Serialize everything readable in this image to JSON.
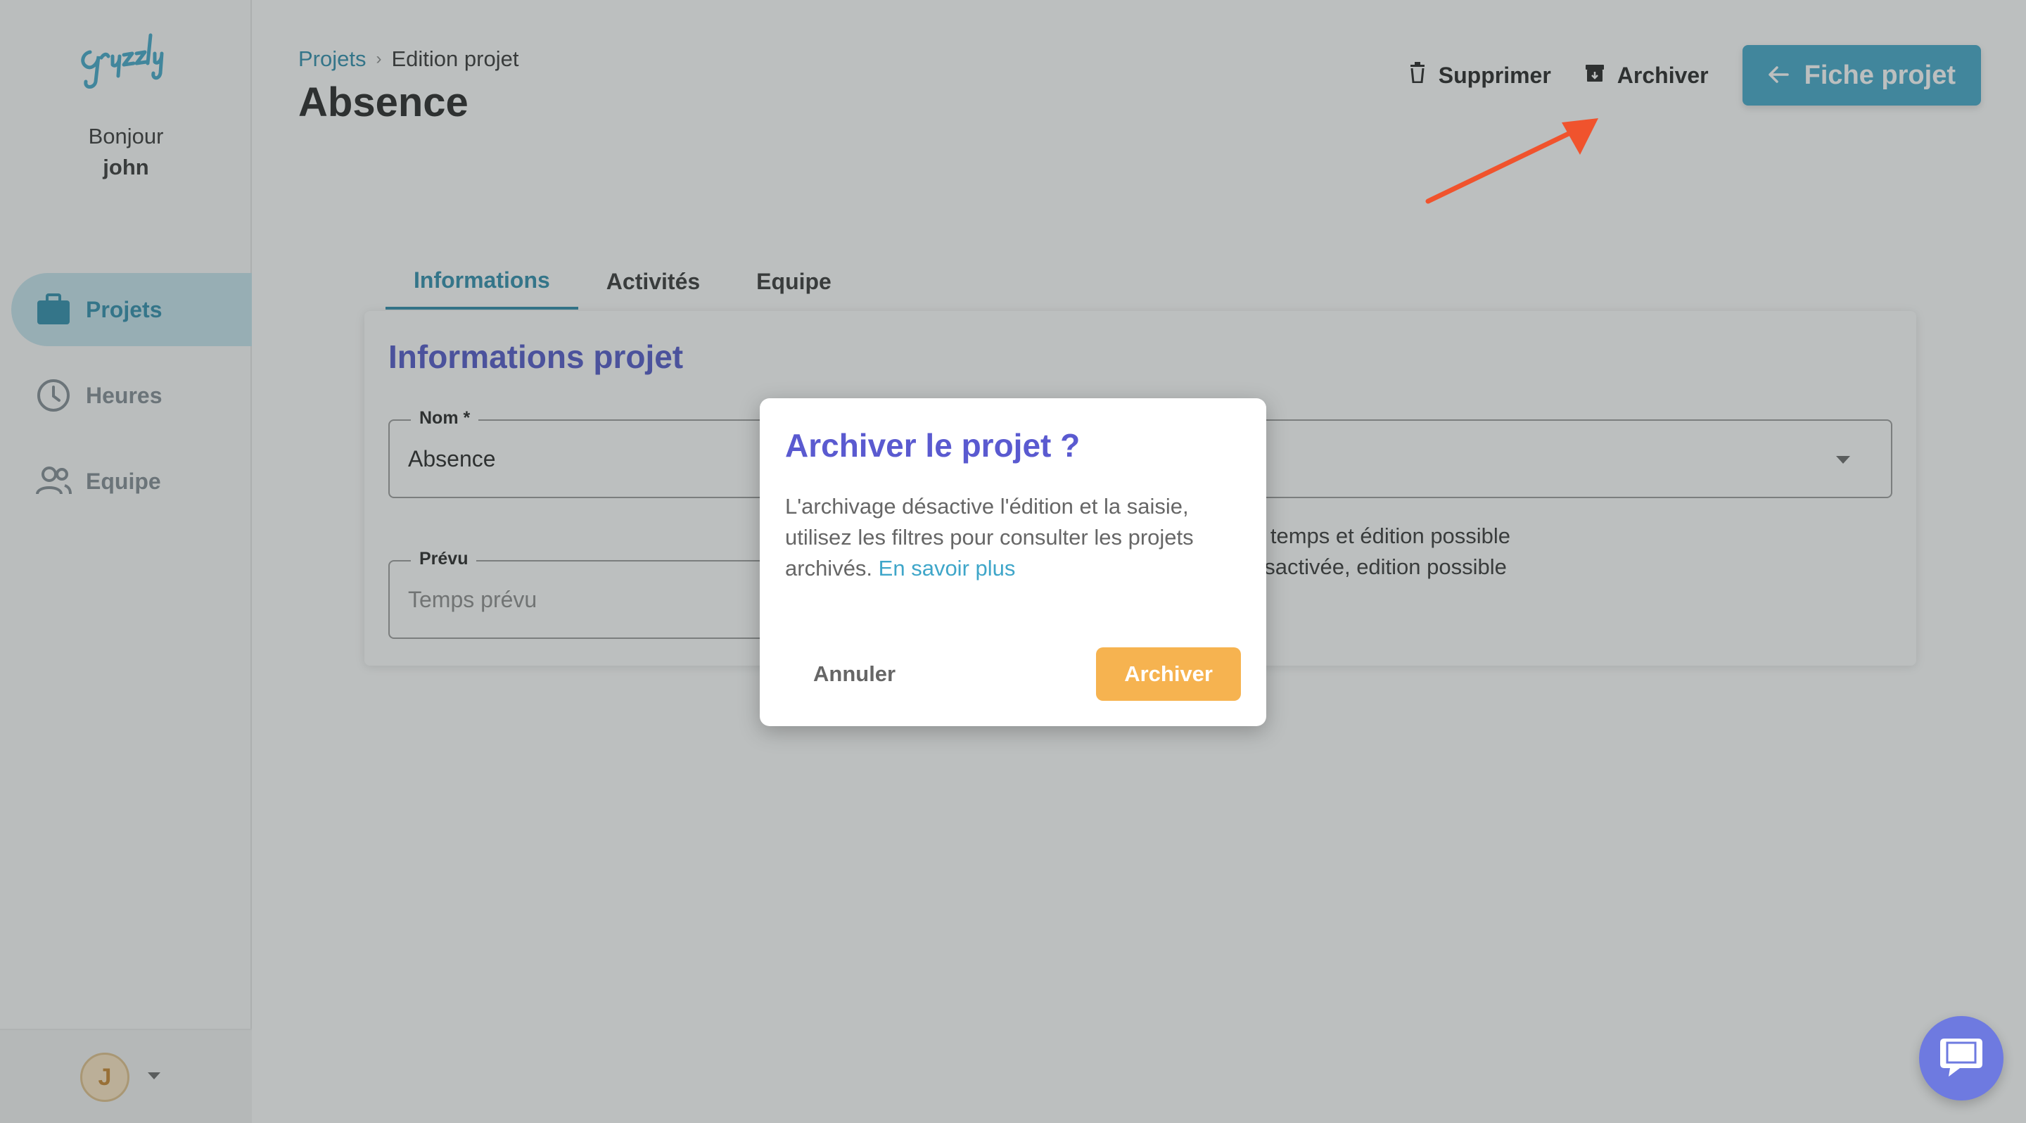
{
  "sidebar": {
    "greeting": "Bonjour",
    "user_name": "john",
    "items": [
      {
        "label": "Projets",
        "icon": "briefcase-icon",
        "active": true
      },
      {
        "label": "Heures",
        "icon": "clock-icon",
        "active": false
      },
      {
        "label": "Equipe",
        "icon": "users-icon",
        "active": false
      }
    ],
    "avatar_initial": "J"
  },
  "header": {
    "breadcrumb": {
      "parent": "Projets",
      "current": "Edition projet"
    },
    "title": "Absence",
    "actions": {
      "delete_label": "Supprimer",
      "archive_label": "Archiver",
      "primary_label": "Fiche projet"
    }
  },
  "tabs": [
    {
      "label": "Informations",
      "active": true
    },
    {
      "label": "Activités",
      "active": false
    },
    {
      "label": "Equipe",
      "active": false
    }
  ],
  "card": {
    "title": "Informations projet",
    "name_field": {
      "label": "Nom *",
      "value": "Absence"
    },
    "planned_field": {
      "label": "Prévu",
      "placeholder": "Temps prévu"
    },
    "visible_option_fragments": [
      "u temps et édition possible",
      "ésactivée, edition possible"
    ]
  },
  "dialog": {
    "title": "Archiver le projet ?",
    "body": "L'archivage désactive l'édition et la saisie, utilisez les filtres pour consulter les projets archivés.",
    "link": "En savoir plus",
    "cancel_label": "Annuler",
    "confirm_label": "Archiver"
  },
  "colors": {
    "brand": "#3fa6c9",
    "heading": "#4f55c8",
    "confirm": "#f6b350",
    "annotation": "#f0532d",
    "chat": "#6e7ae0"
  }
}
